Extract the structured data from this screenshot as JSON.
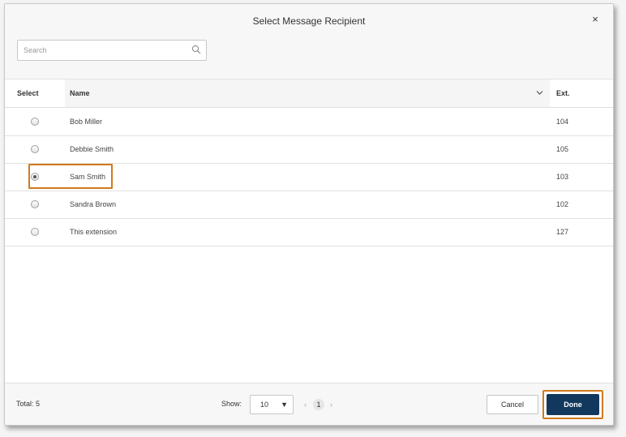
{
  "dialog": {
    "title": "Select Message Recipient",
    "close_icon": "×"
  },
  "search": {
    "placeholder": "Search",
    "value": ""
  },
  "table": {
    "headers": {
      "select": "Select",
      "name": "Name",
      "ext": "Ext."
    },
    "rows": [
      {
        "name": "Bob Miller",
        "ext": "104",
        "selected": false
      },
      {
        "name": "Debbie Smith",
        "ext": "105",
        "selected": false
      },
      {
        "name": "Sam Smith",
        "ext": "103",
        "selected": true
      },
      {
        "name": "Sandra Brown",
        "ext": "102",
        "selected": false
      },
      {
        "name": "This extension",
        "ext": "127",
        "selected": false
      }
    ]
  },
  "footer": {
    "total": "Total: 5",
    "show_label": "Show:",
    "show_value": "10",
    "show_caret": "▼",
    "pagination": {
      "prev": "‹",
      "current": "1",
      "next": "›"
    },
    "cancel_label": "Cancel",
    "done_label": "Done"
  },
  "colors": {
    "done_bg": "#12385e",
    "highlight": "#d07a1e"
  }
}
